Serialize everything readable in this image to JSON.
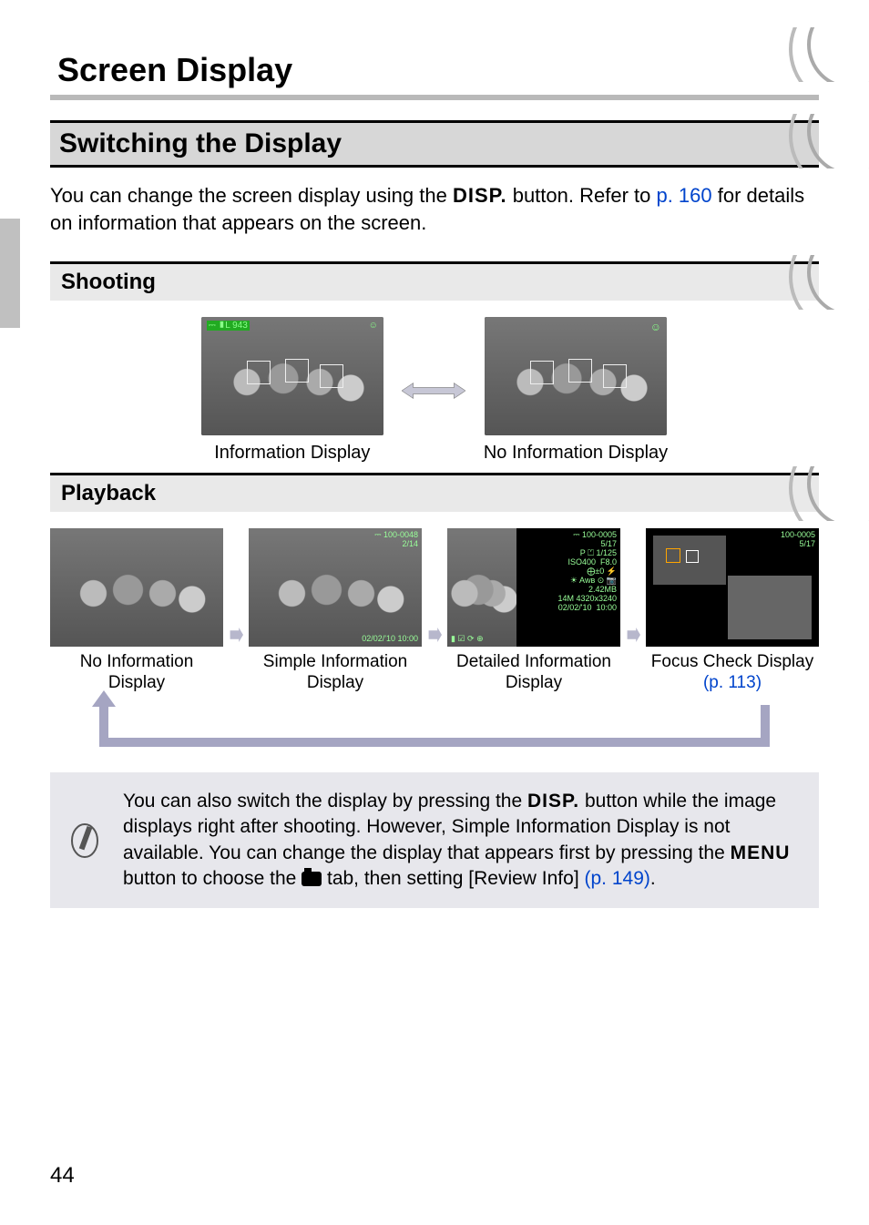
{
  "page_number": "44",
  "h1": "Screen Display",
  "h2": "Switching the Display",
  "intro": {
    "part1": "You can change the screen display using the ",
    "disp_glyph": "DISP.",
    "part2": " button. Refer to ",
    "link": "p. 160",
    "part3": " for details on information that appears on the screen."
  },
  "shooting": {
    "heading": "Shooting",
    "thumbs": [
      {
        "hud_left": "⎓  ▮L  943",
        "caption": "Information Display"
      },
      {
        "caption": "No Information Display"
      }
    ]
  },
  "playback": {
    "heading": "Playback",
    "items": [
      {
        "line1": "No Information",
        "line2": "Display"
      },
      {
        "line1": "Simple Information",
        "line2": "Display",
        "overlay": {
          "tr": "⎓ 100-0048\n2/14",
          "br": "02/02/'10  10:00"
        }
      },
      {
        "line1": "Detailed Information",
        "line2": "Display",
        "overlay": {
          "tr": "⎓ 100-0005\n5/17\nP ⏍ 1/125\nISO400  F8.0\n⨁±0 ⚡\n☀ Aᴡʙ ⊙ 📷\n2.42MB\n14M 4320x3240\n02/02/'10  10:00",
          "bl": "▮ ☑ ⟳ ⊕"
        }
      },
      {
        "line1": "Focus Check Display",
        "link": "(p. 113)",
        "overlay": {
          "tr": "100-0005\n5/17"
        }
      }
    ]
  },
  "note": {
    "part1": "You can also switch the display by pressing the ",
    "disp": "DISP.",
    "part2": " button while the image displays right after shooting. However, Simple Information Display is not available. You can change the display that appears first by pressing the ",
    "menu": "MENU",
    "part3": " button to choose the ",
    "part4": " tab, then setting [Review Info] ",
    "link": "(p. 149)",
    "part5": "."
  }
}
